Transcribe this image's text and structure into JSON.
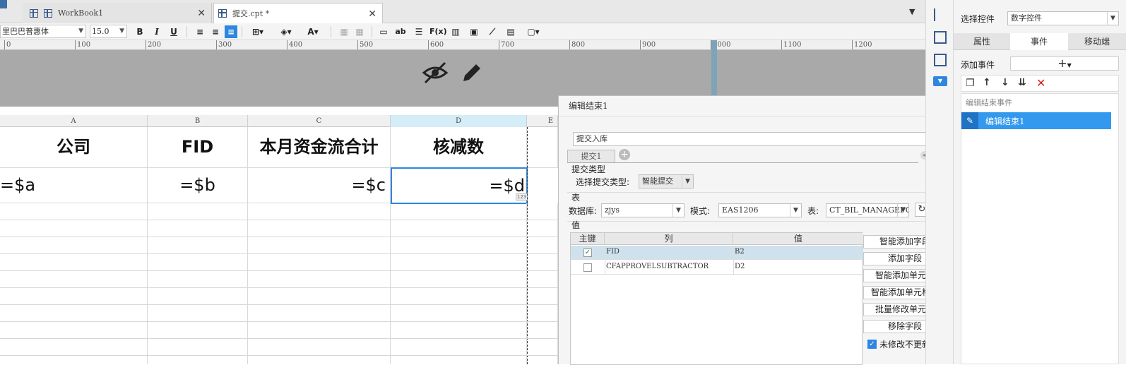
{
  "tabs": [
    {
      "label": "WorkBook1"
    },
    {
      "label": "提交.cpt *"
    }
  ],
  "toolbar": {
    "font_name": "里巴巴普惠体",
    "font_size": "15.0",
    "bold": "B",
    "italic": "I",
    "underline": "U",
    "fx": "F(x)",
    "ab": "ab"
  },
  "ruler": [
    "0",
    "100",
    "200",
    "300",
    "400",
    "500",
    "600",
    "700",
    "800",
    "900",
    "1000",
    "1100",
    "1200"
  ],
  "sheet": {
    "columns": [
      "A",
      "B",
      "C",
      "D",
      "E"
    ],
    "header_row": [
      "公司",
      "FID",
      "本月资金流合计",
      "核减数"
    ],
    "data_row": [
      "=$a",
      "=$b",
      "=$c",
      "=$d"
    ],
    "cell_badge": "123"
  },
  "right_panel": {
    "select_control_label": "选择控件",
    "select_control_value": "数字控件",
    "tabs": [
      "属性",
      "事件",
      "移动端"
    ],
    "add_event_label": "添加事件",
    "add_event_button": "+",
    "event_group": "编辑结束事件",
    "event_item": "编辑结束1"
  },
  "dialog": {
    "title": "编辑结束1",
    "action": "提交入库",
    "subtab": "提交1",
    "submit_type_section": "提交类型",
    "submit_type_label": "选择提交类型:",
    "submit_type_value": "智能提交",
    "table_section": "表",
    "db_label": "数据库:",
    "db_value": "zjys",
    "schema_label": "模式:",
    "schema_value": "EAS1206",
    "table_label": "表:",
    "table_value": "CT_BIL_MANAGEFOI",
    "value_section": "值",
    "grid_headers": [
      "主键",
      "列",
      "值"
    ],
    "grid_rows": [
      {
        "key": true,
        "column": "FID",
        "value": "B2"
      },
      {
        "key": false,
        "column": "CFAPPROVELSUBTRACTOR",
        "value": "D2"
      }
    ],
    "buttons": [
      "智能添加字段",
      "添加字段",
      "智能添加单元格",
      "智能添加单元格组",
      "批量修改单元格",
      "移除字段"
    ],
    "no_update_label": "未修改不更新",
    "help": "?"
  },
  "colors": {
    "accent": "#2e86de",
    "selected_row": "#3399ee",
    "gray_band": "#a9a9a9",
    "close_red": "#e02020"
  }
}
